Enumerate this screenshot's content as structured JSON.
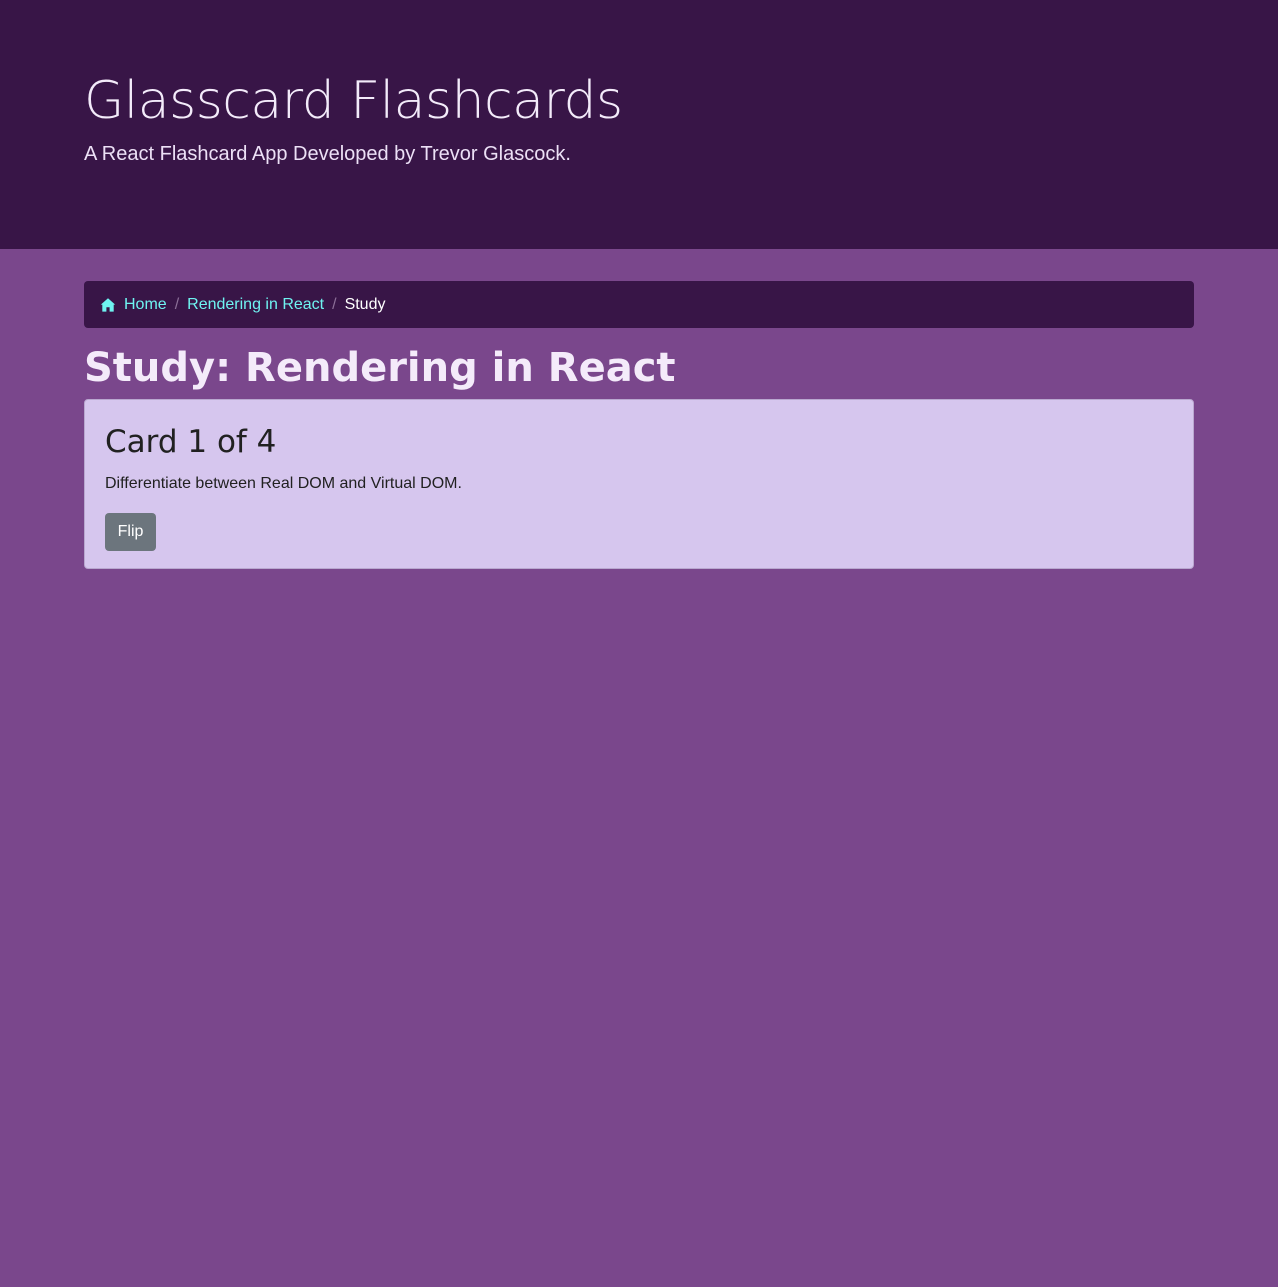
{
  "header": {
    "title": "Glasscard Flashcards",
    "subtitle": "A React Flashcard App Developed by Trevor Glascock."
  },
  "breadcrumb": {
    "home_icon": "home-icon",
    "items": [
      {
        "label": "Home"
      },
      {
        "label": "Rendering in React"
      },
      {
        "label": "Study"
      }
    ],
    "separator": "/"
  },
  "page": {
    "title": "Study: Rendering in React"
  },
  "card": {
    "title": "Card 1 of 4",
    "text": "Differentiate between Real DOM and Virtual DOM.",
    "flip_label": "Flip"
  },
  "colors": {
    "header_bg": "#381547",
    "page_bg": "#7a478c",
    "link": "#6ff3f1",
    "card_bg": "#d6c6ee",
    "button_bg": "#6c757d"
  }
}
